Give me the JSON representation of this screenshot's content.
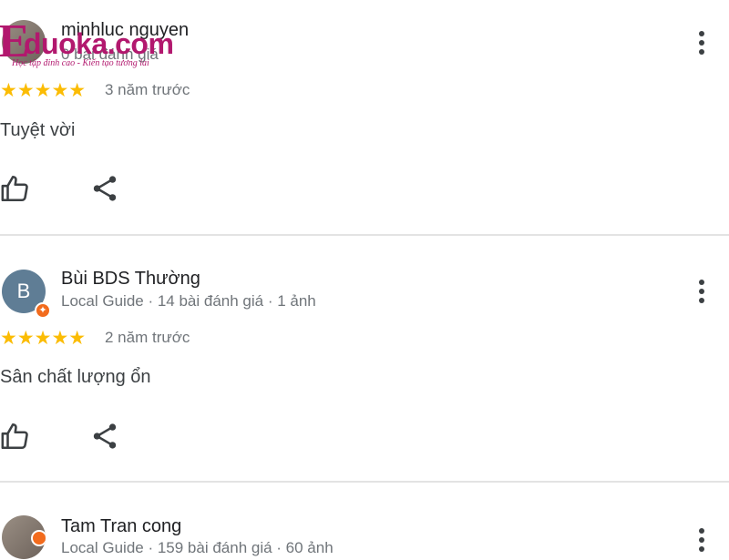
{
  "watermark": {
    "brand": "duoka.com",
    "initial": "E",
    "tagline": "Học tập đỉnh cao - Kiến tạo tương lai"
  },
  "reviews": [
    {
      "name": "minhluc nguyen",
      "meta": "0 bài đánh giá",
      "stars": "★★★★★",
      "rating": 5,
      "time": "3 năm trước",
      "text": "Tuyệt vời",
      "avatar": "photo"
    },
    {
      "name": "Bùi BDS Thường",
      "meta": "Local Guide · 14 bài đánh giá · 1 ảnh",
      "stars": "★★★★★",
      "rating": 5,
      "time": "2 năm trước",
      "text": "Sân chất lượng ổn",
      "avatar_letter": "B",
      "avatar": "letter"
    },
    {
      "name": "Tam Tran cong",
      "meta": "Local Guide · 159 bài đánh giá · 60 ảnh",
      "avatar": "photo"
    }
  ],
  "colors": {
    "star": "#fbbc04",
    "brand": "#b2186e",
    "badge": "#f26b1d",
    "divider": "#e3e3e3"
  }
}
